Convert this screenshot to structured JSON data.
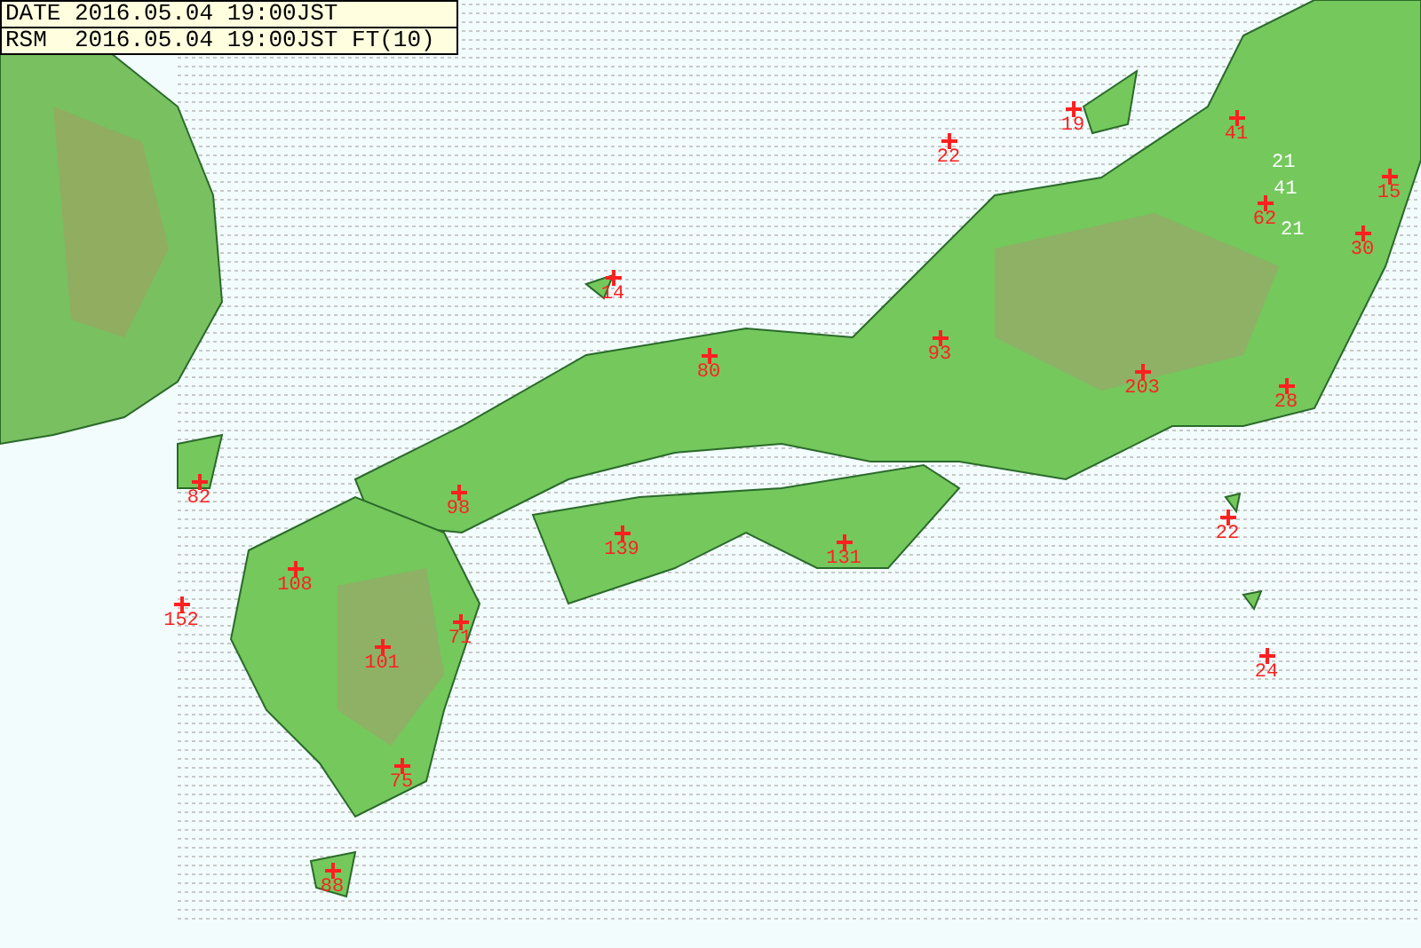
{
  "header": {
    "date_line": "DATE 2016.05.04 19:00JST",
    "model_line": "RSM  2016.05.04 19:00JST FT(10)"
  },
  "markers": [
    {
      "value": "19"
    },
    {
      "value": "41"
    },
    {
      "value": "22"
    },
    {
      "value": "15"
    },
    {
      "value": "62"
    },
    {
      "value": "30"
    },
    {
      "value": "14"
    },
    {
      "value": "93"
    },
    {
      "value": "80"
    },
    {
      "value": "203"
    },
    {
      "value": "28"
    },
    {
      "value": "82"
    },
    {
      "value": "98"
    },
    {
      "value": "22"
    },
    {
      "value": "139"
    },
    {
      "value": "131"
    },
    {
      "value": "108"
    },
    {
      "value": "152"
    },
    {
      "value": "71"
    },
    {
      "value": "101"
    },
    {
      "value": "24"
    },
    {
      "value": "75"
    },
    {
      "value": "88"
    }
  ],
  "contour_labels": [
    "21",
    "41",
    "21"
  ]
}
